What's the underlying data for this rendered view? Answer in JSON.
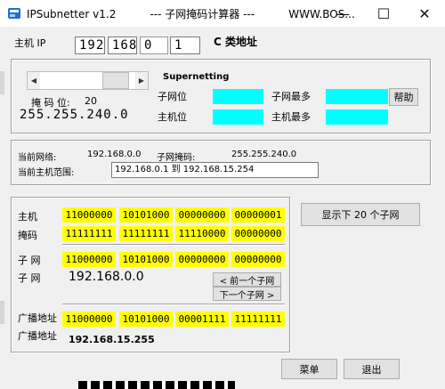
{
  "window": {
    "title": "IPSubnetter v1.2          --- 子网掩码计算器 ---          WWW.BOS..."
  },
  "ip": {
    "label": "主机 IP",
    "octets": [
      "192",
      "168",
      "0",
      "1"
    ],
    "class_label": "C 类地址"
  },
  "mask": {
    "bits_label": "掩 码 位:",
    "bits_value": "20",
    "mask_value": "255.255.240.0"
  },
  "supernet": {
    "header": "Supernetting",
    "subnet_bits_label": "子网位",
    "host_bits_label": "主机位",
    "max_subnets_label": "子网最多",
    "max_hosts_label": "主机最多",
    "help_button": "帮助"
  },
  "network": {
    "current_network_label": "当前网络:",
    "current_network_value": "192.168.0.0",
    "subnet_mask_label": "子网掩码:",
    "subnet_mask_value": "255.255.240.0",
    "host_range_label": "当前主机范围:",
    "host_range_value": "192.168.0.1  到  192.168.15.254"
  },
  "binary": {
    "host_label": "主机",
    "host_bits": [
      "11000000",
      "10101000",
      "00000000",
      "00000001"
    ],
    "mask_label": "掩码",
    "mask_bits": [
      "11111111",
      "11111111",
      "11110000",
      "00000000"
    ],
    "subnet_label_1": "子 网",
    "subnet_bits": [
      "11000000",
      "10101000",
      "00000000",
      "00000000"
    ],
    "subnet_label_2": "子 网",
    "subnet_value": "192.168.0.0",
    "prev_button": "< 前一个子网",
    "next_button": "下一个子网 >",
    "broadcast_label_1": "广播地址",
    "broadcast_bits": [
      "11000000",
      "10101000",
      "00001111",
      "11111111"
    ],
    "broadcast_label_2": "广播地址",
    "broadcast_value": "192.168.15.255"
  },
  "actions": {
    "show_subnets_button": "显示下 20 个子网",
    "menu_button": "菜单",
    "exit_button": "退出"
  },
  "colors": {
    "bit_highlight": "#ffff00",
    "info_field": "#00ffff"
  }
}
